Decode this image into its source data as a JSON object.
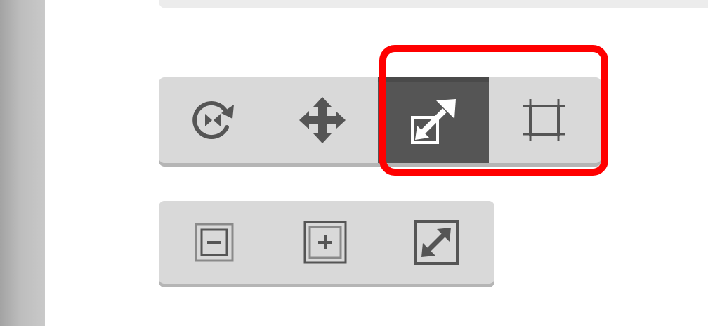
{
  "colors": {
    "toolbar_bg": "#d9d9d9",
    "icon": "#555555",
    "active_bg": "#555555",
    "active_icon": "#ffffff",
    "highlight": "#ff0000",
    "rail": "#bdbdbd"
  },
  "transform_toolbar": {
    "tools": [
      {
        "icon": "rotate-flip-icon",
        "active": false
      },
      {
        "icon": "move-arrows-icon",
        "active": false
      },
      {
        "icon": "scale-diagonal-icon",
        "active": true
      },
      {
        "icon": "crop-icon",
        "active": false
      }
    ]
  },
  "zoom_toolbar": {
    "tools": [
      {
        "icon": "zoom-out-icon",
        "active": false
      },
      {
        "icon": "zoom-in-icon",
        "active": false
      },
      {
        "icon": "fit-to-screen-icon",
        "active": false
      }
    ]
  },
  "annotation": {
    "highlight": "red-rounded-rectangle"
  }
}
